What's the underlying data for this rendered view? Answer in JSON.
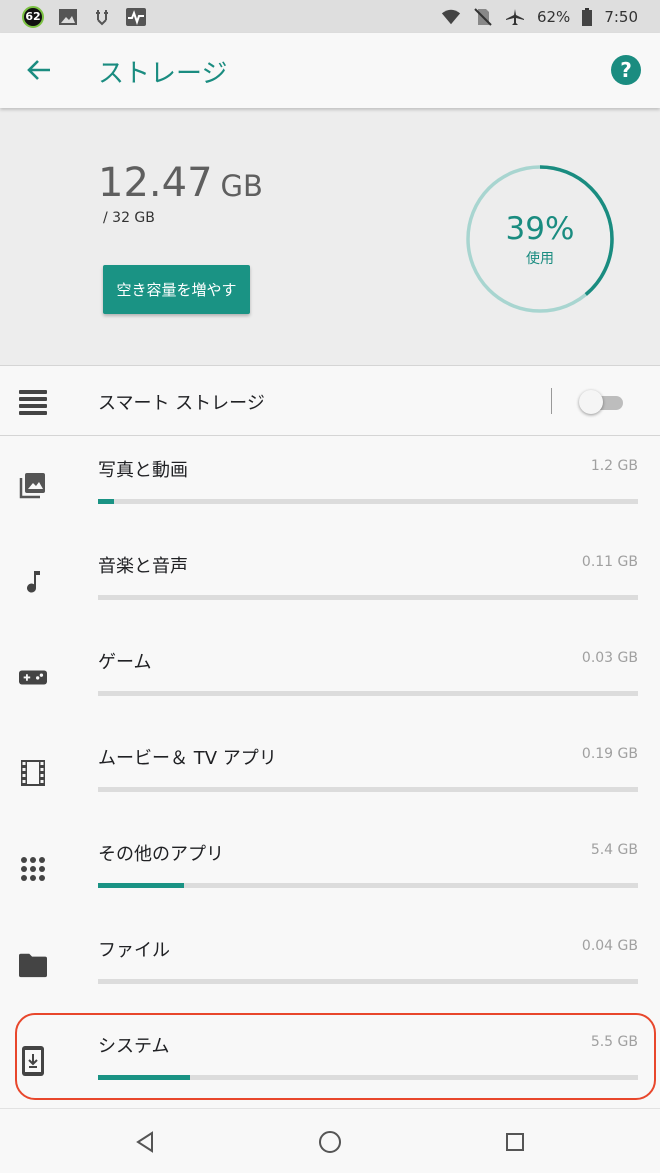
{
  "status_bar": {
    "notification_badge": "62",
    "battery_percent": "62%",
    "time": "7:50",
    "icons": [
      "image-icon",
      "usb-icon",
      "activity-icon",
      "wifi-icon",
      "no-sim-icon",
      "airplane-icon",
      "battery-icon"
    ]
  },
  "app_bar": {
    "title": "ストレージ",
    "back_icon": "arrow-back-icon",
    "help_icon": "help-icon",
    "help_glyph": "?"
  },
  "summary": {
    "used_value": "12.47",
    "used_unit": "GB",
    "total": "/ 32 GB",
    "free_up_button": "空き容量を増やす",
    "percent_used_label": "39%",
    "percent_used": 0.39,
    "used_caption": "使用"
  },
  "smart_storage": {
    "label": "スマート ストレージ",
    "enabled": false
  },
  "categories": [
    {
      "label": "写真と動画",
      "size": "1.2 GB",
      "fraction": 0.03,
      "icon": "photo-icon"
    },
    {
      "label": "音楽と音声",
      "size": "0.11 GB",
      "fraction": 0.0,
      "icon": "music-note-icon"
    },
    {
      "label": "ゲーム",
      "size": "0.03 GB",
      "fraction": 0.0,
      "icon": "gamepad-icon"
    },
    {
      "label": "ムービー＆ TV アプリ",
      "size": "0.19 GB",
      "fraction": 0.0,
      "icon": "movie-icon"
    },
    {
      "label": "その他のアプリ",
      "size": "5.4 GB",
      "fraction": 0.16,
      "icon": "apps-grid-icon"
    },
    {
      "label": "ファイル",
      "size": "0.04 GB",
      "fraction": 0.0,
      "icon": "folder-icon"
    },
    {
      "label": "システム",
      "size": "5.5 GB",
      "fraction": 0.17,
      "icon": "system-update-icon"
    }
  ],
  "colors": {
    "accent": "#1a8c80",
    "button": "#1a9384",
    "ring_track": "#a8d5d0",
    "highlight": "#e8472c"
  }
}
